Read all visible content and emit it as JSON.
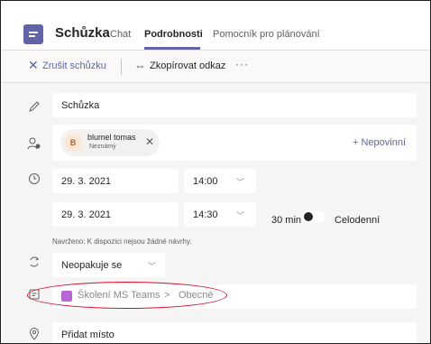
{
  "header": {
    "title": "Schůzka",
    "tabs": [
      {
        "label": "Chat"
      },
      {
        "label": "Podrobnosti",
        "active": true
      },
      {
        "label": "Pomocník pro plánování"
      }
    ]
  },
  "toolbar": {
    "cancel_label": "Zrušit schůzku",
    "copy_label": "Zkopírovat odkaz",
    "more_label": "···"
  },
  "form": {
    "title_value": "Schůzka",
    "attendee": {
      "initial": "B",
      "name": "blumel tomas",
      "status": "Neznámý"
    },
    "optional_label": "+ Nepovinní",
    "start_date": "29. 3. 2021",
    "start_time": "14:00",
    "end_date": "29. 3. 2021",
    "end_time": "14:30",
    "duration": "30 min",
    "all_day_label": "Celodenní",
    "suggestion": "Navrženo: K dispozici nejsou žádné návrhy.",
    "repeat_value": "Neopakuje se",
    "channel_team": "Školení MS Teams",
    "channel_separator": ">",
    "channel_name": "Obecné",
    "location_placeholder": "Přidat místo"
  },
  "colors": {
    "accent": "#6264a7",
    "highlight_ellipse": "#d9112f",
    "channel_icon": "#b768d6"
  },
  "icons": [
    "calendar-app-icon",
    "close-icon",
    "link-icon",
    "pencil-icon",
    "people-icon",
    "clock-icon",
    "repeat-icon",
    "channel-icon",
    "location-icon"
  ]
}
